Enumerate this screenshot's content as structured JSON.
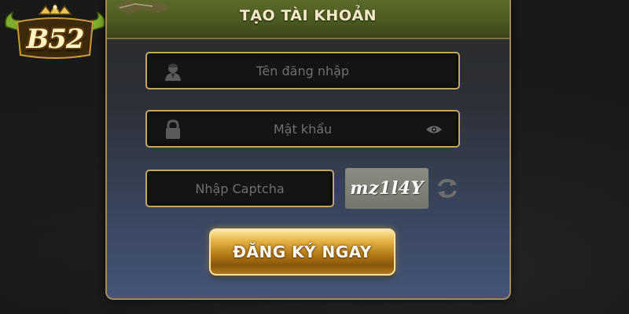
{
  "logo": {
    "text": "B52"
  },
  "form": {
    "title": "TẠO TÀI KHOẢN",
    "username": {
      "placeholder": "Tên đăng nhập",
      "value": "",
      "icon": "user-icon"
    },
    "password": {
      "placeholder": "Mật khẩu",
      "value": "",
      "icon": "lock-icon",
      "toggle_icon": "eye-icon"
    },
    "captcha": {
      "placeholder": "Nhập Captcha",
      "value": "",
      "code": "mz1l4Y",
      "refresh_icon": "refresh-icon"
    },
    "submit_label": "ĐĂNG KÝ NGAY"
  },
  "colors": {
    "background": "#181818",
    "panel_border": "#a08a5a",
    "header": "#4d5a22",
    "field_border": "#bfa768",
    "button_gold": "#c8901e",
    "captcha_bg": "#82817a"
  }
}
